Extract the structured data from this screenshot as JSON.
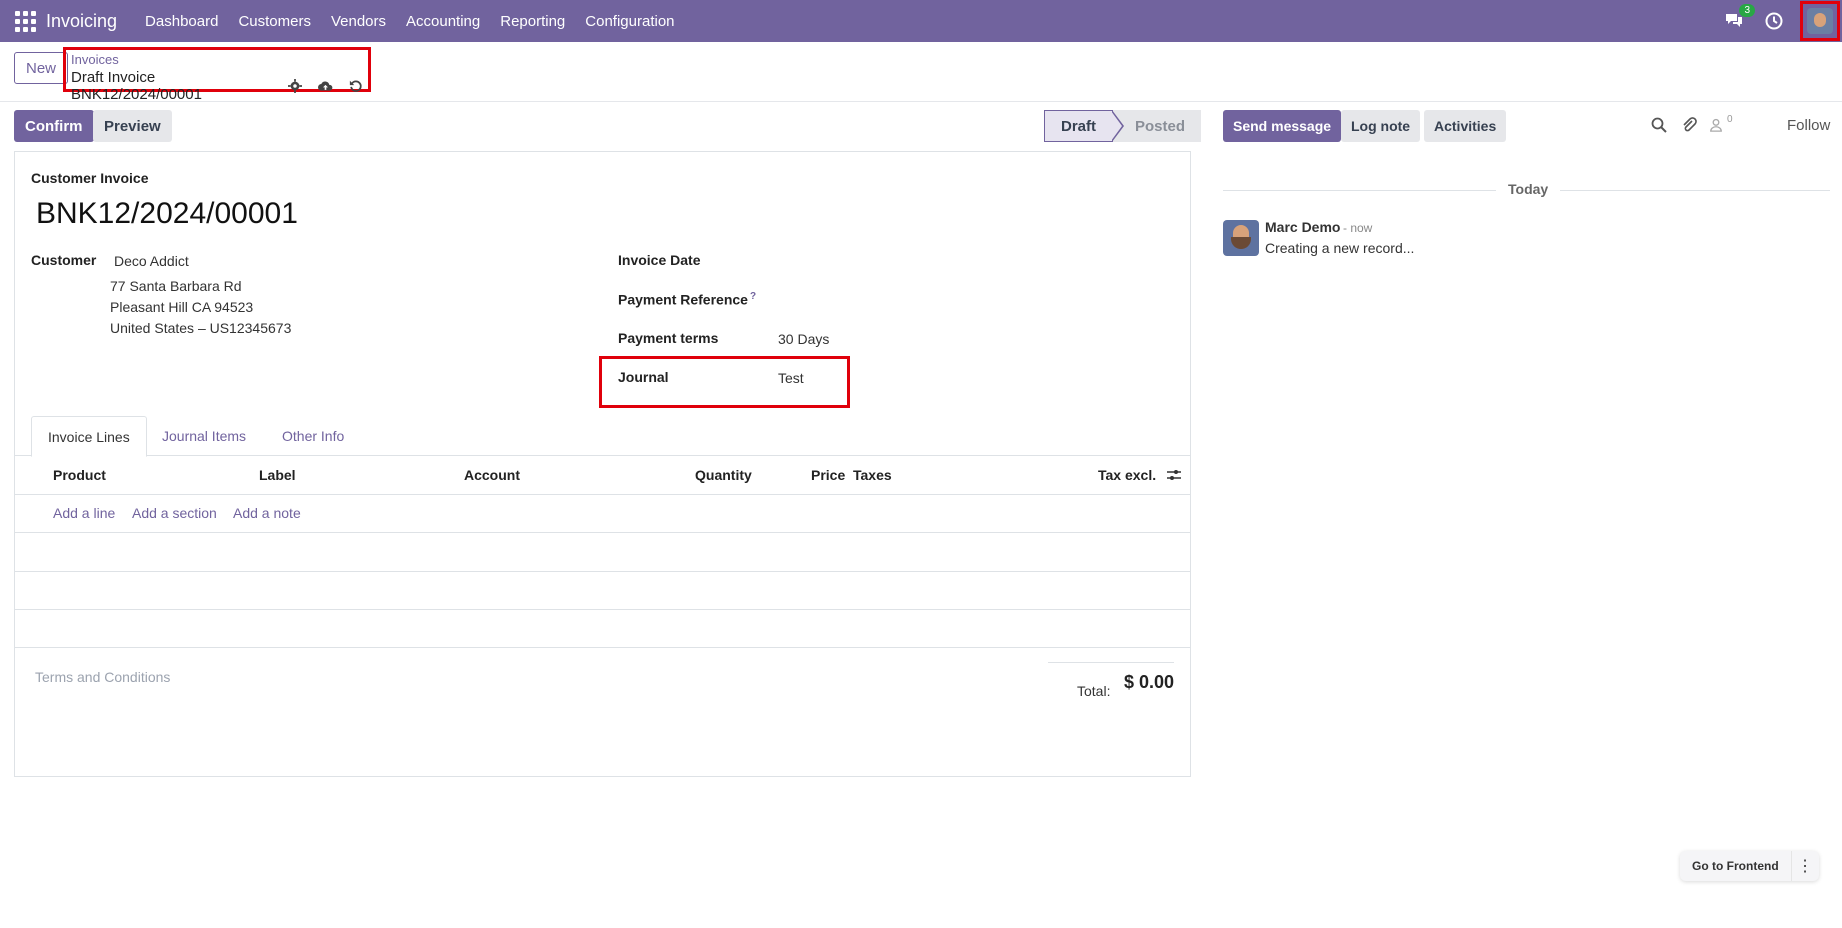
{
  "navbar": {
    "brand": "Invoicing",
    "menu": [
      "Dashboard",
      "Customers",
      "Vendors",
      "Accounting",
      "Reporting",
      "Configuration"
    ],
    "messages_badge": "3"
  },
  "control": {
    "new_label": "New",
    "breadcrumb_parent": "Invoices",
    "breadcrumb_current": "Draft Invoice BNK12/2024/00001"
  },
  "actions": {
    "confirm": "Confirm",
    "preview": "Preview"
  },
  "status": {
    "active": "Draft",
    "inactive": "Posted"
  },
  "form": {
    "doc_type": "Customer Invoice",
    "name": "BNK12/2024/00001",
    "customer_label": "Customer",
    "customer_name": "Deco Addict",
    "address_line1": "77 Santa Barbara Rd",
    "address_line2": "Pleasant Hill CA 94523",
    "address_line3": "United States – US12345673",
    "invoice_date_label": "Invoice Date",
    "payment_reference_label": "Payment Reference",
    "help_mark": "?",
    "payment_terms_label": "Payment terms",
    "payment_terms_value": "30 Days",
    "journal_label": "Journal",
    "journal_value": "Test"
  },
  "tabs": [
    "Invoice Lines",
    "Journal Items",
    "Other Info"
  ],
  "lines": {
    "headers": [
      "Product",
      "Label",
      "Account",
      "Quantity",
      "Price",
      "Taxes",
      "Tax excl."
    ],
    "add_line": "Add a line",
    "add_section": "Add a section",
    "add_note": "Add a note"
  },
  "footer": {
    "terms_placeholder": "Terms and Conditions",
    "total_label": "Total:",
    "total_value": "$ 0.00"
  },
  "chatter": {
    "send_message": "Send message",
    "log_note": "Log note",
    "activities": "Activities",
    "follower_count": "0",
    "follow": "Follow",
    "date_separator": "Today",
    "author": "Marc Demo",
    "time": "- now",
    "body": "Creating a new record..."
  },
  "floating": {
    "go_frontend": "Go to Frontend"
  },
  "colors": {
    "brand": "#71639e",
    "highlight": "#e0000b",
    "badge": "#28a745"
  }
}
